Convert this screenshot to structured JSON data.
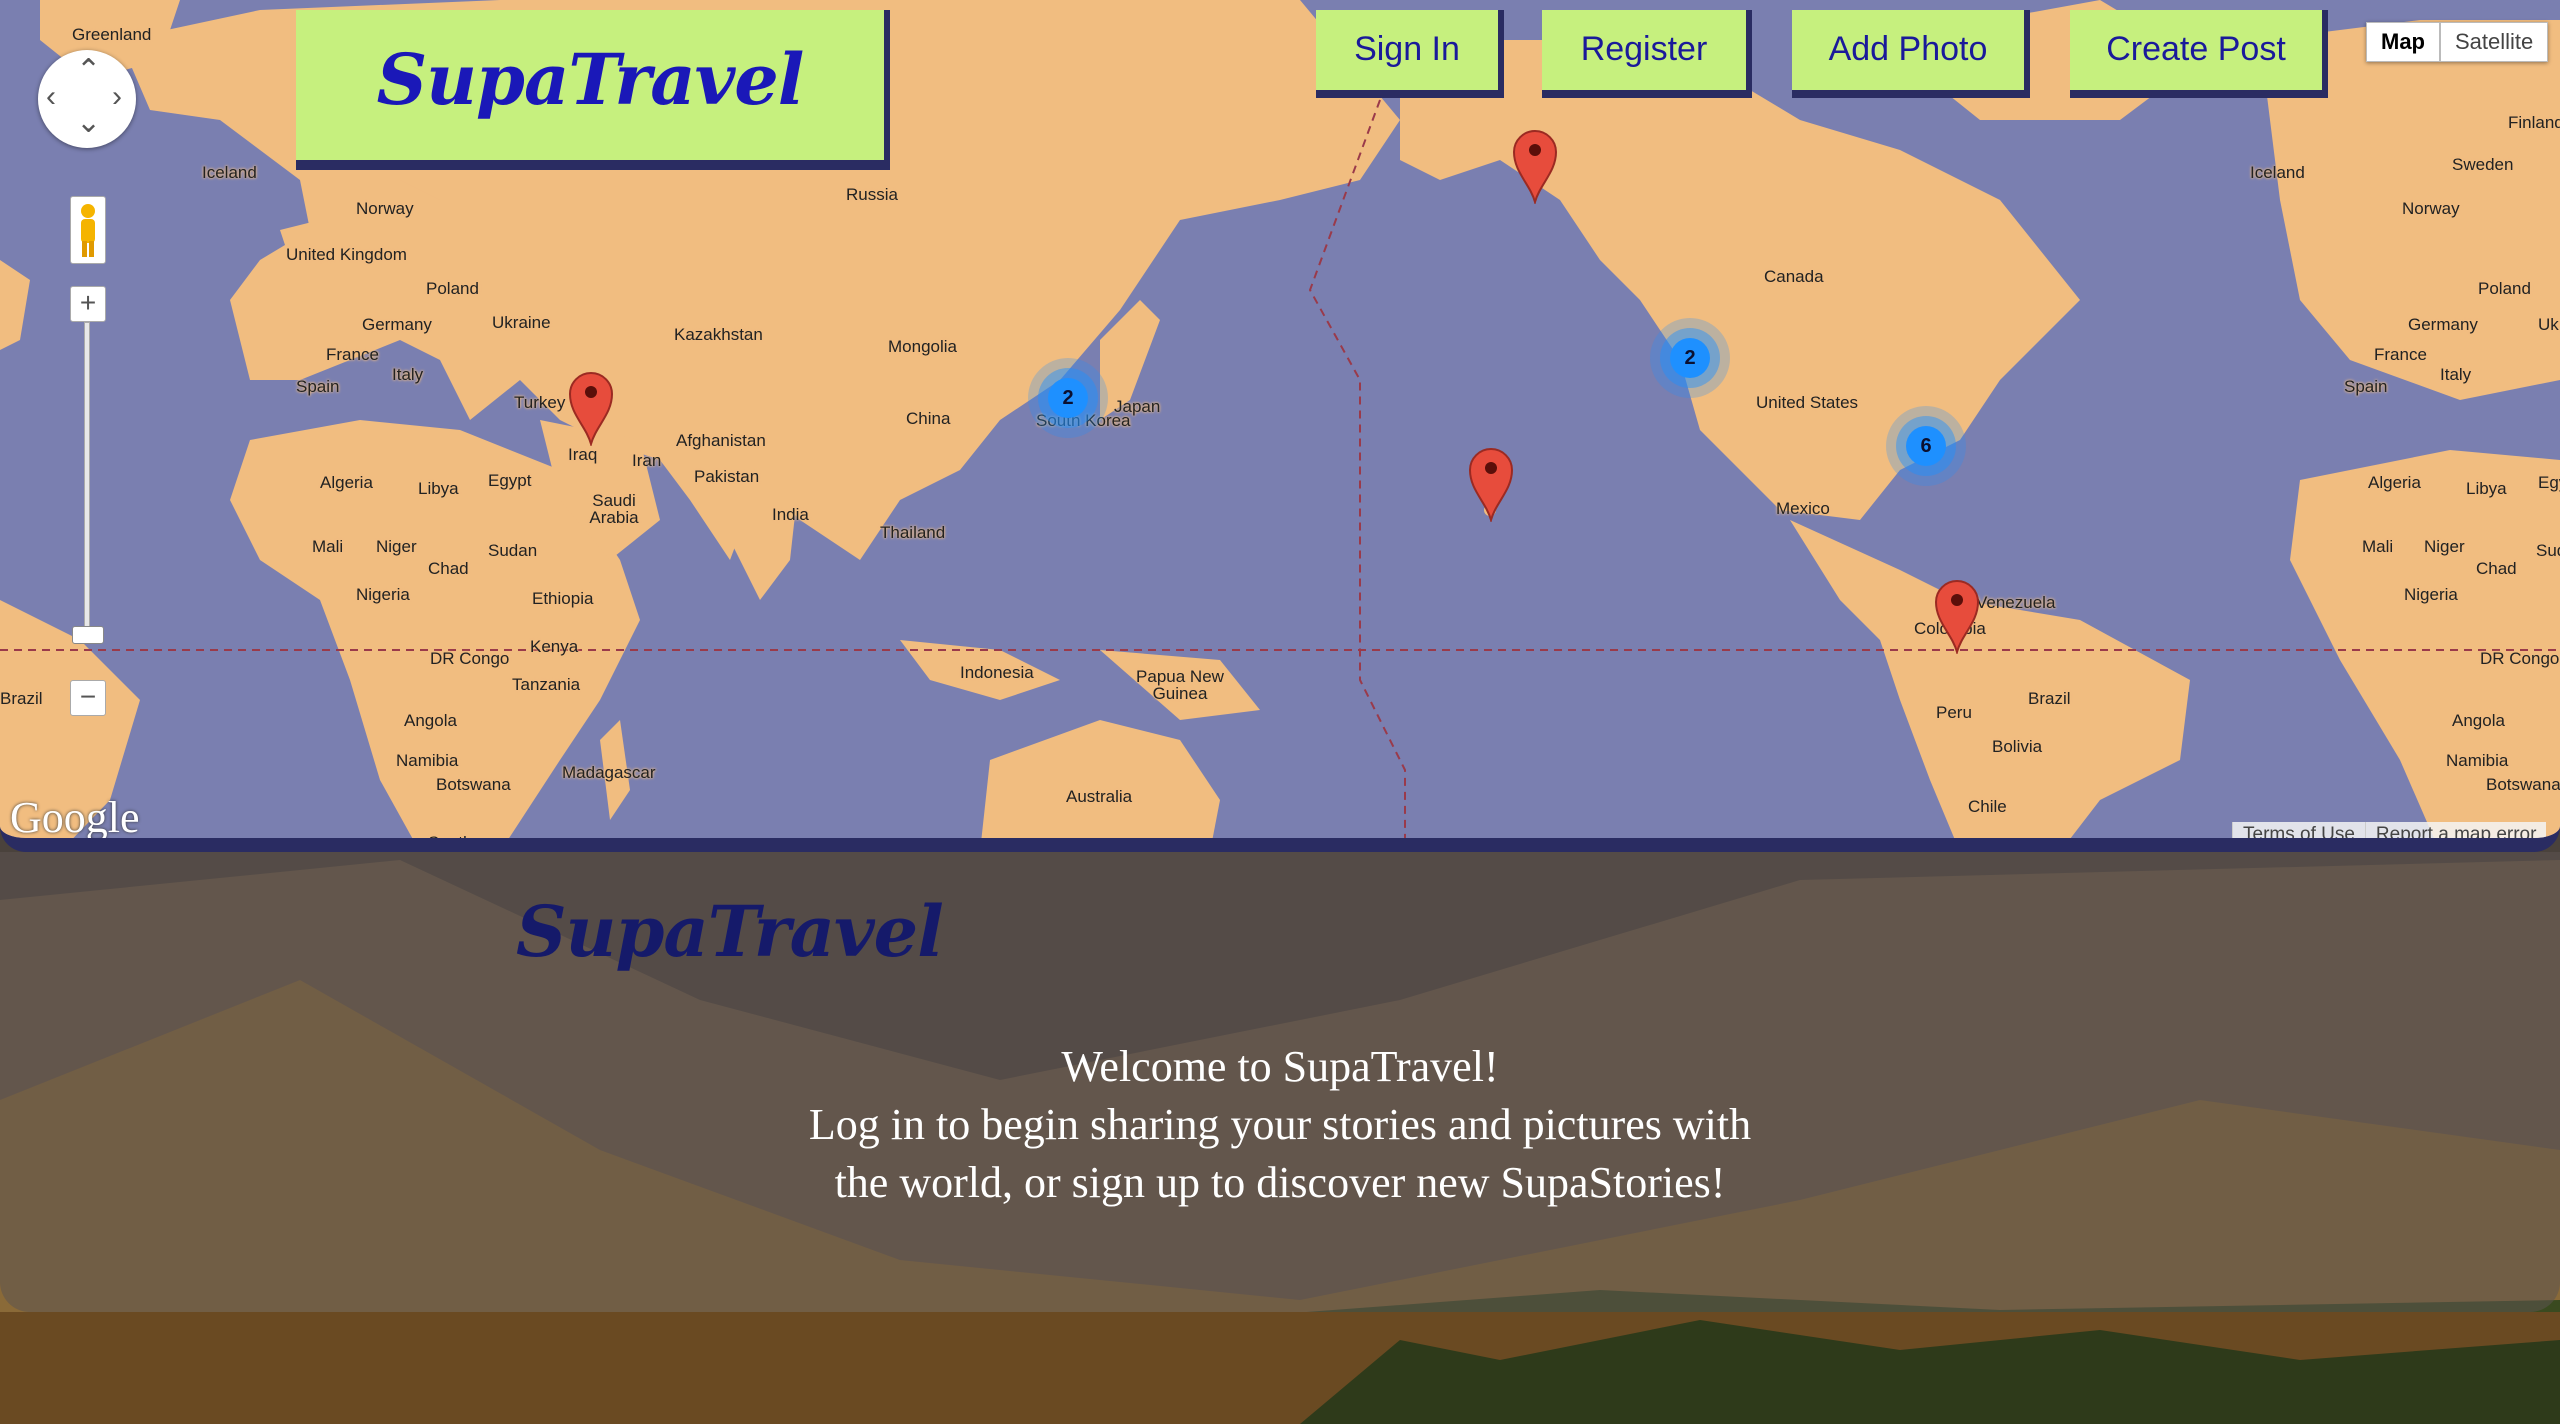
{
  "header": {
    "logo": "SupaTravel",
    "nav": [
      {
        "label": "Sign In"
      },
      {
        "label": "Register"
      },
      {
        "label": "Add Photo"
      },
      {
        "label": "Create Post"
      }
    ]
  },
  "map": {
    "type_control": {
      "map": "Map",
      "satellite": "Satellite",
      "selected": "Map"
    },
    "attribution": {
      "logo": "Google",
      "terms": "Terms of Use",
      "report": "Report a map error"
    },
    "colors": {
      "ocean": "#7a7fb0",
      "land": "#f1bd80",
      "pin": "#e74c3c",
      "cluster": "#1e90ff"
    },
    "labels": [
      "Greenland",
      "Iceland",
      "Norway",
      "Finland",
      "Russia",
      "United Kingdom",
      "Poland",
      "Germany",
      "Ukraine",
      "France",
      "Italy",
      "Spain",
      "Kazakhstan",
      "Mongolia",
      "Turkey",
      "Iraq",
      "Iran",
      "Afghanistan",
      "Pakistan",
      "China",
      "Japan",
      "South Korea",
      "India",
      "Saudi Arabia",
      "Algeria",
      "Libya",
      "Egypt",
      "Mali",
      "Niger",
      "Chad",
      "Sudan",
      "Nigeria",
      "Ethiopia",
      "Thailand",
      "Kenya",
      "DR Congo",
      "Tanzania",
      "Angola",
      "Namibia",
      "Botswana",
      "Madagascar",
      "South",
      "Brazil",
      "Indonesia",
      "Papua New Guinea",
      "Australia",
      "Canada",
      "United States",
      "Mexico",
      "Venezuela",
      "Colombia",
      "Peru",
      "Bolivia",
      "Chile",
      "Sweden",
      "Uk",
      "Egy",
      "Sud"
    ],
    "clusters": [
      {
        "count": "2",
        "region": "Korea"
      },
      {
        "count": "2",
        "region": "US West Coast"
      },
      {
        "count": "6",
        "region": "US East Coast"
      }
    ],
    "pins": [
      "Iraq",
      "Alaska",
      "Hawaii",
      "Colombia"
    ]
  },
  "content": {
    "logo": "SupaTravel",
    "welcome_line1": "Welcome to SupaTravel!",
    "welcome_line2": "Log in to begin sharing your stories and pictures with",
    "welcome_line3": "the world, or sign up to discover new SupaStories!"
  }
}
